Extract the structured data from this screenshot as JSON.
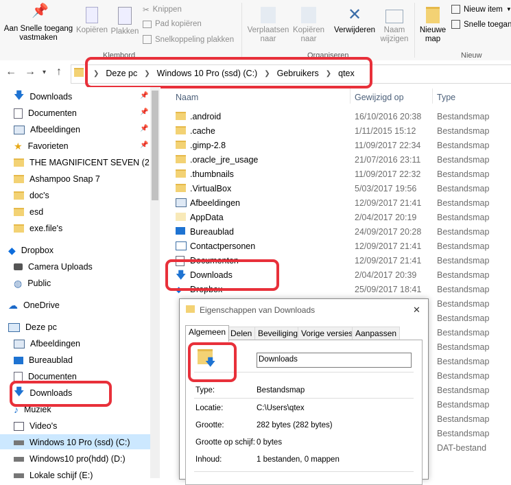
{
  "ribbon": {
    "pin_label": "Aan Snelle toegang vastmaken",
    "copy_label": "Kopiëren",
    "paste_label": "Plakken",
    "cut_label": "Knippen",
    "copy_path_label": "Pad kopiëren",
    "paste_shortcut_label": "Snelkoppeling plakken",
    "clipboard_group": "Klembord",
    "move_label": "Verplaatsen naar",
    "copyto_label": "Kopiëren naar",
    "delete_label": "Verwijderen",
    "rename_label": "Naam wijzigen",
    "organize_group": "Organiseren",
    "newfolder_label": "Nieuwe map",
    "newitem_label": "Nieuw item",
    "easyaccess_label": "Snelle toegang",
    "new_group": "Nieuw"
  },
  "address": {
    "crumbs": [
      "Deze pc",
      "Windows 10 Pro (ssd) (C:)",
      "Gebruikers",
      "qtex"
    ]
  },
  "navpane": {
    "quick": [
      "Downloads",
      "Documenten",
      "Afbeeldingen",
      "Favorieten",
      "THE MAGNIFICENT SEVEN (2",
      "Ashampoo Snap 7",
      "doc's",
      "esd",
      "exe.file's"
    ],
    "dropbox": "Dropbox",
    "dropbox_items": [
      "Camera Uploads",
      "Public"
    ],
    "onedrive": "OneDrive",
    "thispc": "Deze pc",
    "pc_items": [
      "Afbeeldingen",
      "Bureaublad",
      "Documenten",
      "Downloads",
      "Muziek",
      "Video's"
    ],
    "drives": [
      "Windows 10 Pro (ssd) (C:)",
      "Windows10 pro(hdd) (D:)",
      "Lokale schijf (E:)"
    ]
  },
  "columns": {
    "name": "Naam",
    "date": "Gewijzigd op",
    "type": "Type"
  },
  "files": [
    {
      "name": ".android",
      "date": "16/10/2016 20:38",
      "type": "Bestandsmap"
    },
    {
      "name": ".cache",
      "date": "1/11/2015 15:12",
      "type": "Bestandsmap"
    },
    {
      "name": ".gimp-2.8",
      "date": "11/09/2017 22:34",
      "type": "Bestandsmap"
    },
    {
      "name": ".oracle_jre_usage",
      "date": "21/07/2016 23:11",
      "type": "Bestandsmap"
    },
    {
      "name": ".thumbnails",
      "date": "11/09/2017 22:32",
      "type": "Bestandsmap"
    },
    {
      "name": ".VirtualBox",
      "date": "5/03/2017 19:56",
      "type": "Bestandsmap"
    },
    {
      "name": "Afbeeldingen",
      "date": "12/09/2017 21:41",
      "type": "Bestandsmap"
    },
    {
      "name": "AppData",
      "date": "2/04/2017 20:19",
      "type": "Bestandsmap"
    },
    {
      "name": "Bureaublad",
      "date": "24/09/2017 20:28",
      "type": "Bestandsmap"
    },
    {
      "name": "Contactpersonen",
      "date": "12/09/2017 21:41",
      "type": "Bestandsmap"
    },
    {
      "name": "Documenten",
      "date": "12/09/2017 21:41",
      "type": "Bestandsmap"
    },
    {
      "name": "Downloads",
      "date": "2/04/2017 20:39",
      "type": "Bestandsmap"
    },
    {
      "name": "Dropbox",
      "date": "25/09/2017 18:41",
      "type": "Bestandsmap"
    }
  ],
  "hidden_types": [
    "Bestandsmap",
    "Bestandsmap",
    "Bestandsmap",
    "Bestandsmap",
    "Bestandsmap",
    "Bestandsmap",
    "Bestandsmap",
    "Bestandsmap",
    "Bestandsmap",
    "Bestandsmap",
    "DAT-bestand"
  ],
  "dialog": {
    "title": "Eigenschappen van Downloads",
    "tabs": [
      "Algemeen",
      "Delen",
      "Beveiliging",
      "Vorige versies",
      "Aanpassen"
    ],
    "name_value": "Downloads",
    "props": [
      {
        "label": "Type:",
        "value": "Bestandsmap"
      },
      {
        "label": "Locatie:",
        "value": "C:\\Users\\qtex"
      },
      {
        "label": "Grootte:",
        "value": "282 bytes (282 bytes)"
      },
      {
        "label": "Grootte op schijf:",
        "value": "0 bytes"
      },
      {
        "label": "Inhoud:",
        "value": "1 bestanden, 0 mappen"
      }
    ],
    "close_glyph": "✕"
  },
  "colors": {
    "highlight": "#e8303a",
    "selection": "#cce8ff",
    "folder": "#f3d274",
    "arrow": "#1e73d2"
  }
}
